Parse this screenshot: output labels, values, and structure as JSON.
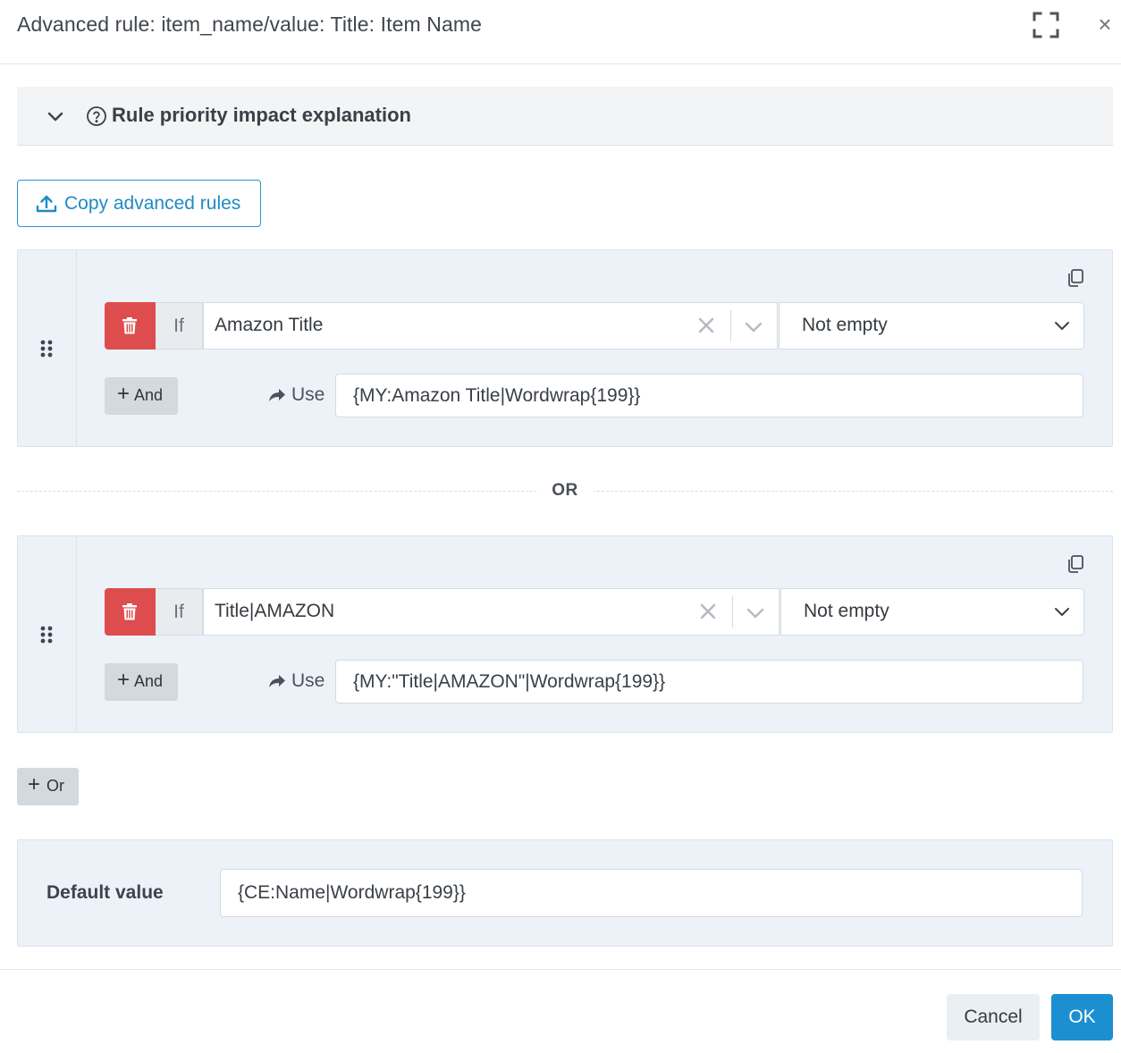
{
  "dialog": {
    "title": "Advanced rule: item_name/value: Title: Item Name",
    "expand_icon": "expand-icon",
    "close_icon": "close-icon",
    "close_glyph": "×"
  },
  "accordion": {
    "label": "Rule priority impact explanation",
    "expanded": false
  },
  "copy_button": {
    "label": "Copy advanced rules"
  },
  "rules": [
    {
      "if_label": "If",
      "field": "Amazon Title",
      "operator": "Not empty",
      "and_label": "And",
      "use_label": "Use",
      "use_value": "{MY:Amazon Title|Wordwrap{199}}"
    },
    {
      "if_label": "If",
      "field": "Title|AMAZON",
      "operator": "Not empty",
      "and_label": "And",
      "use_label": "Use",
      "use_value": "{MY:\"Title|AMAZON\"|Wordwrap{199}}"
    }
  ],
  "or_separator": "OR",
  "add_or_button": {
    "label": "Or"
  },
  "default_value": {
    "label": "Default value",
    "value": "{CE:Name|Wordwrap{199}}"
  },
  "footer": {
    "cancel_label": "Cancel",
    "ok_label": "OK"
  },
  "colors": {
    "primary": "#1c8fd0",
    "danger": "#de4d4d",
    "panel_bg": "#edf2f8"
  }
}
